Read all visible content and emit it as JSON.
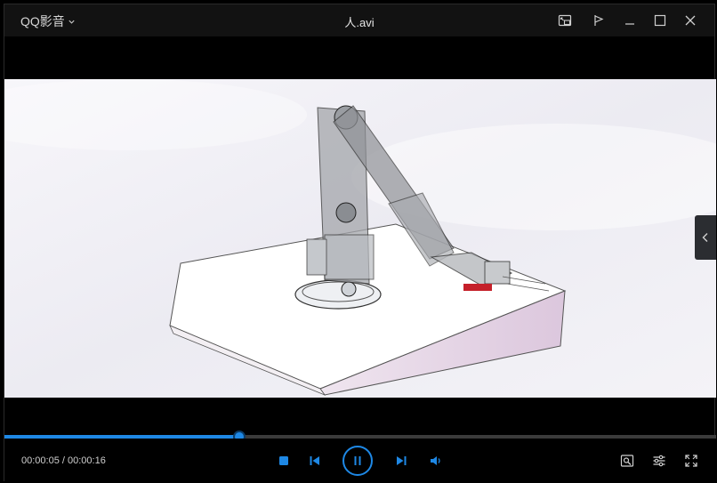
{
  "app": {
    "brand": "QQ影音",
    "title": "人.avi"
  },
  "player": {
    "current_time": "00:00:05",
    "separator": " / ",
    "total_time": "00:00:16",
    "progress": 0.33
  },
  "colors": {
    "accent": "#1e88e5",
    "titlebar": "#121212",
    "background": "#000000"
  },
  "icons": {
    "titlebar": [
      "pip-icon",
      "pin-icon",
      "minimize-icon",
      "maximize-icon",
      "close-icon"
    ],
    "controls": [
      "stop-icon",
      "previous-icon",
      "pause-icon",
      "next-icon",
      "volume-icon"
    ],
    "right_controls": [
      "screenshot-icon",
      "settings-sliders-icon",
      "fullscreen-icon"
    ]
  }
}
